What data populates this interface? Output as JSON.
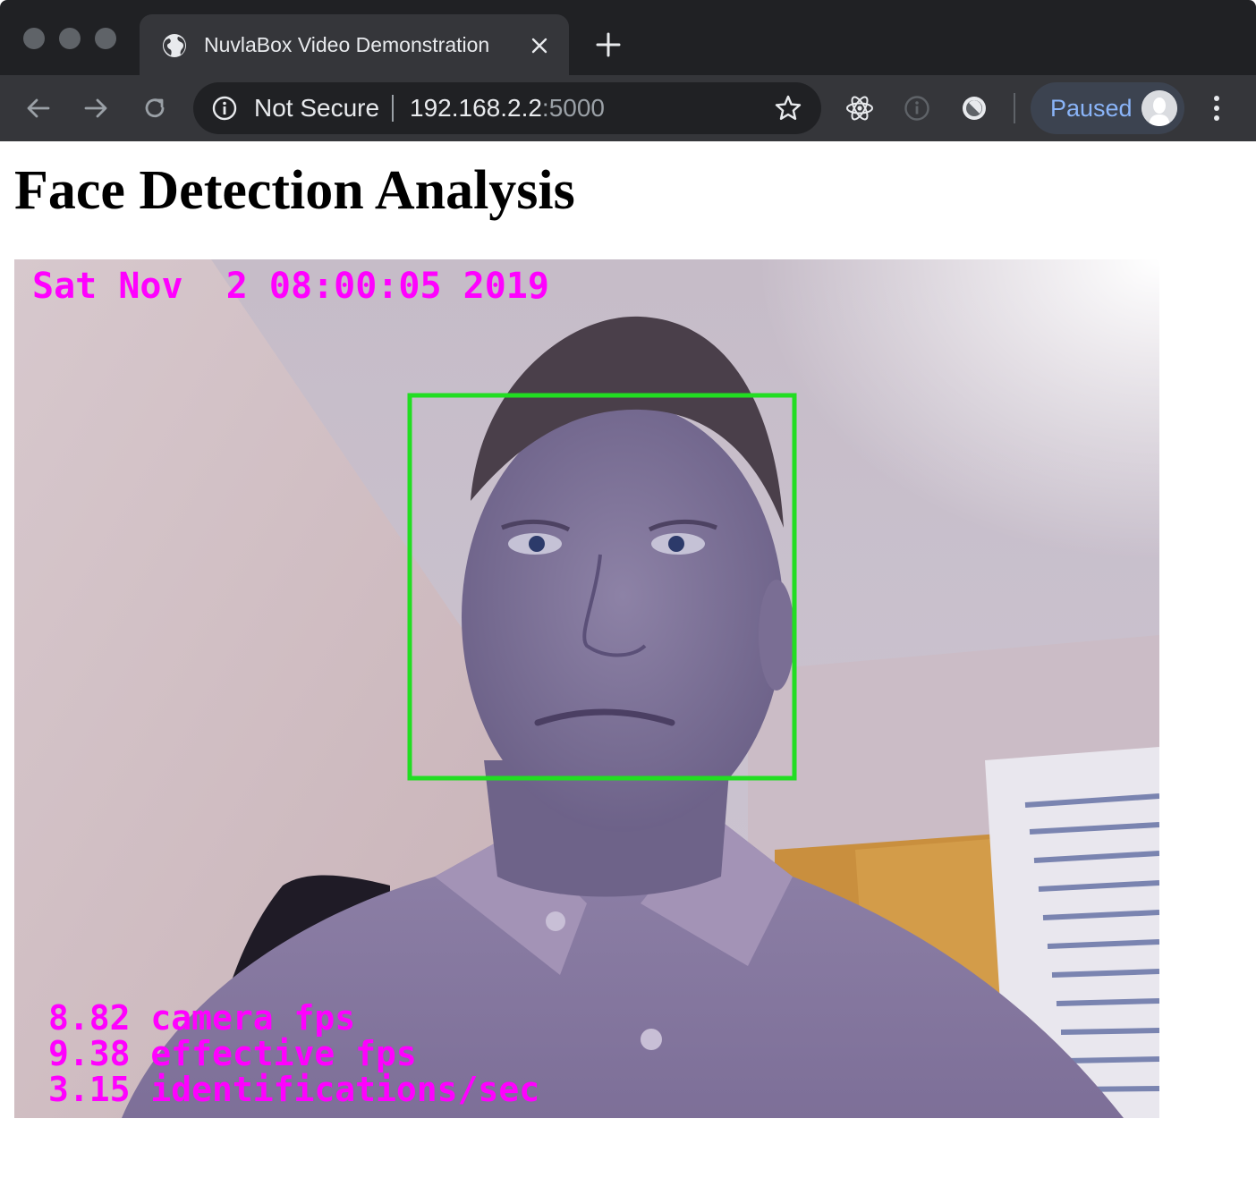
{
  "browser": {
    "tab": {
      "title": "NuvlaBox Video Demonstration"
    },
    "address": {
      "security_label": "Not Secure",
      "host": "192.168.2.2",
      "port": ":5000"
    },
    "profile": {
      "label": "Paused"
    }
  },
  "page": {
    "title": "Face Detection Analysis",
    "video": {
      "timestamp": "Sat Nov  2 08:00:05 2019",
      "stats": [
        "8.82 camera fps",
        "9.38 effective fps",
        "3.15 identifications/sec"
      ],
      "overlay_color": "#ff00ff",
      "detection_box_color": "#22dd22"
    }
  },
  "colors": {
    "chrome_dark": "#202124",
    "toolbar": "#35363a",
    "profile_text": "#8ab4f8"
  }
}
